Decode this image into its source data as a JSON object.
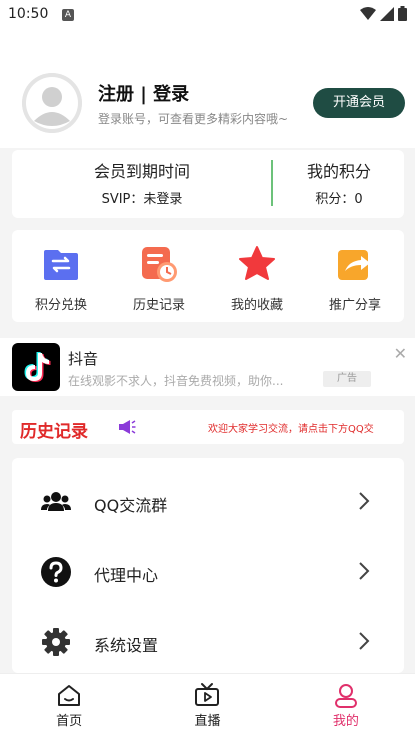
{
  "status_bar": {
    "time": "10:50"
  },
  "profile": {
    "name": "注册 | 登录",
    "subtitle": "登录账号，可查看更多精彩内容哦~",
    "vip_button": "开通会员"
  },
  "member_card": {
    "expiry_title": "会员到期时间",
    "expiry_value": "SVIP：未登录",
    "points_title": "我的积分",
    "points_value": "积分：0",
    "divider_color": "#6cc27a"
  },
  "features": [
    {
      "label": "积分兑换",
      "icon": "exchange-icon"
    },
    {
      "label": "历史记录",
      "icon": "history-icon"
    },
    {
      "label": "我的收藏",
      "icon": "star-icon"
    },
    {
      "label": "推广分享",
      "icon": "share-icon"
    }
  ],
  "ad": {
    "title": "抖音",
    "description": "在线观影不求人，抖音免费视频，助你...",
    "badge": "广告"
  },
  "history": {
    "title": "历史记录",
    "marquee": "欢迎大家学习交流，请点击下方QQ交"
  },
  "menu": [
    {
      "label": "QQ交流群",
      "icon": "group-icon"
    },
    {
      "label": "代理中心",
      "icon": "question-icon"
    },
    {
      "label": "系统设置",
      "icon": "settings-icon"
    }
  ],
  "bottom_nav": [
    {
      "label": "首页",
      "icon": "home-icon",
      "active": false
    },
    {
      "label": "直播",
      "icon": "tv-icon",
      "active": false
    },
    {
      "label": "我的",
      "icon": "user-icon",
      "active": true
    }
  ],
  "colors": {
    "accent": "#e0306b",
    "vip_button": "#1f4c43",
    "history_red": "#e02a2a"
  }
}
